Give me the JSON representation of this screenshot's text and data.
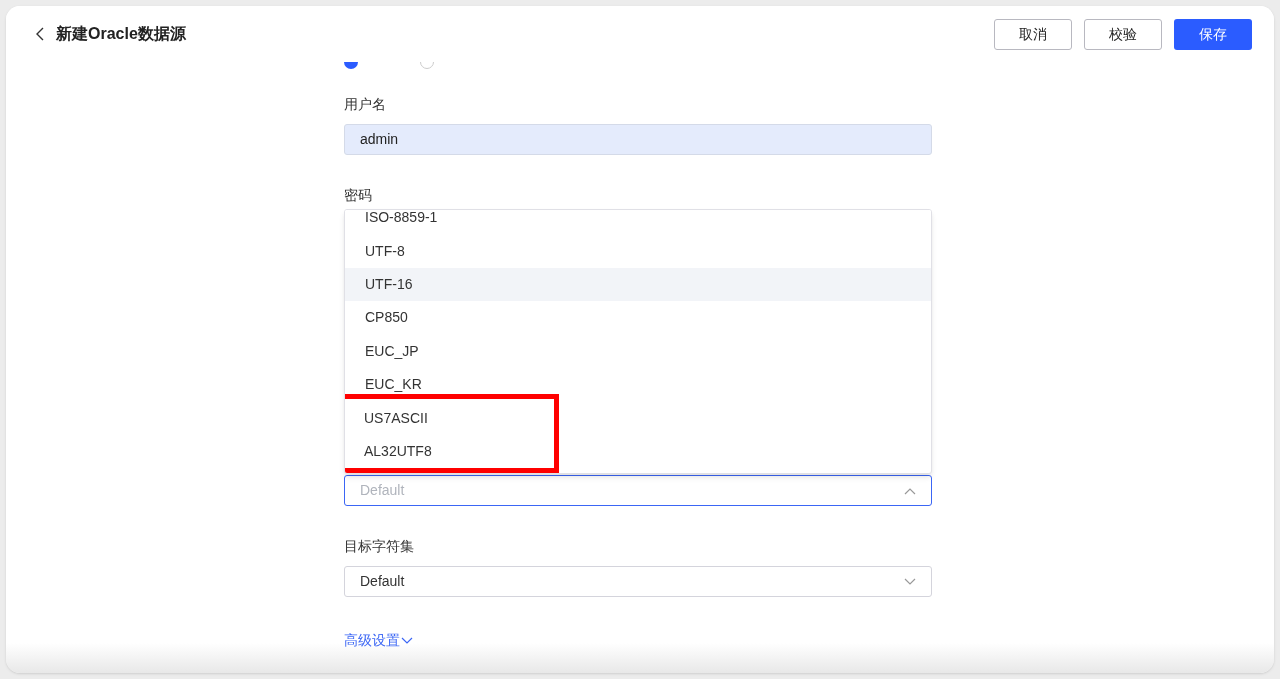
{
  "header": {
    "title": "新建Oracle数据源",
    "buttons": [
      {
        "label": "取消",
        "kind": "default"
      },
      {
        "label": "校验",
        "kind": "default"
      },
      {
        "label": "保存",
        "kind": "primary"
      }
    ]
  },
  "connection_type": [
    {
      "selected": true
    },
    {
      "selected": false
    }
  ],
  "username": {
    "label": "用户名",
    "value": "admin"
  },
  "password": {
    "label": "密码"
  },
  "source_charset": {
    "placeholder": "Default",
    "focused": true,
    "expanded": true,
    "options": [
      {
        "label": "ISO-8859-1",
        "hovered": false,
        "highlighted": false
      },
      {
        "label": "UTF-8",
        "hovered": false,
        "highlighted": false
      },
      {
        "label": "UTF-16",
        "hovered": true,
        "highlighted": false
      },
      {
        "label": "CP850",
        "hovered": false,
        "highlighted": false
      },
      {
        "label": "EUC_JP",
        "hovered": false,
        "highlighted": false
      },
      {
        "label": "EUC_KR",
        "hovered": false,
        "highlighted": false
      },
      {
        "label": "US7ASCII",
        "hovered": false,
        "highlighted": true
      },
      {
        "label": "AL32UTF8",
        "hovered": false,
        "highlighted": true
      }
    ]
  },
  "target_charset": {
    "label": "目标字符集",
    "value": "Default",
    "expanded": false
  },
  "advanced_link": {
    "label": "高级设置",
    "expanded": false
  }
}
